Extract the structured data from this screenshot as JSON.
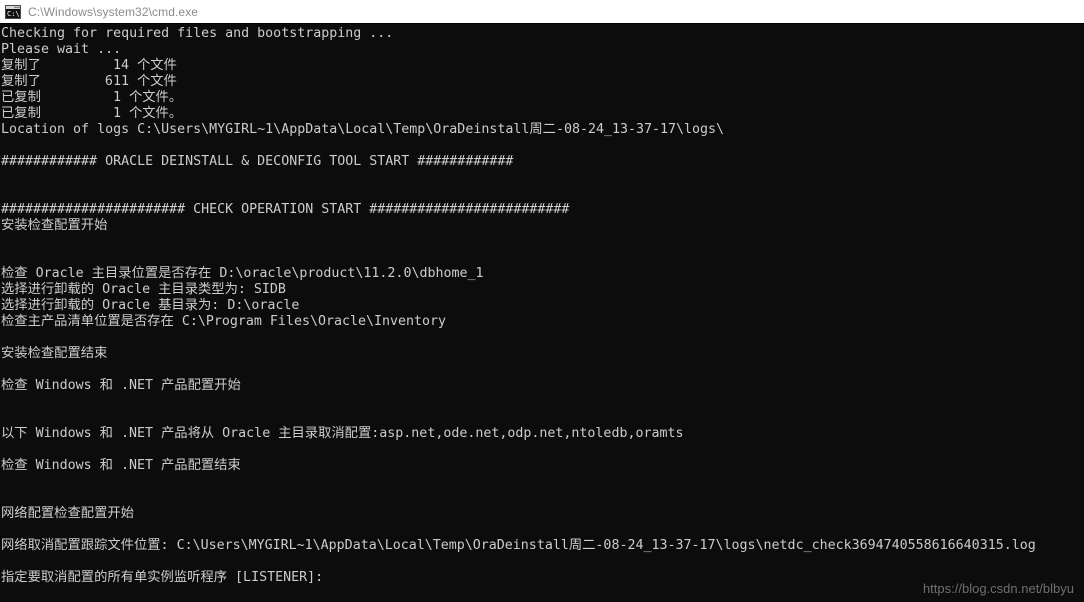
{
  "window": {
    "title": "C:\\Windows\\system32\\cmd.exe",
    "icon": "cmd-console-icon",
    "titlebar_bg": "#ffffff",
    "titlebar_fg": "#8a8a8a",
    "console_bg": "#0c0c0c",
    "console_fg": "#cccccc"
  },
  "console": {
    "lines": [
      "Checking for required files and bootstrapping ...",
      "Please wait ...",
      "复制了         14 个文件",
      "复制了        611 个文件",
      "已复制         1 个文件。",
      "已复制         1 个文件。",
      "Location of logs C:\\Users\\MYGIRL~1\\AppData\\Local\\Temp\\OraDeinstall周二-08-24_13-37-17\\logs\\",
      "",
      "############ ORACLE DEINSTALL & DECONFIG TOOL START ############",
      "",
      "",
      "####################### CHECK OPERATION START #########################",
      "安装检查配置开始",
      "",
      "",
      "检查 Oracle 主目录位置是否存在 D:\\oracle\\product\\11.2.0\\dbhome_1",
      "选择进行卸载的 Oracle 主目录类型为: SIDB",
      "选择进行卸载的 Oracle 基目录为: D:\\oracle",
      "检查主产品清单位置是否存在 C:\\Program Files\\Oracle\\Inventory",
      "",
      "安装检查配置结束",
      "",
      "检查 Windows 和 .NET 产品配置开始",
      "",
      "",
      "以下 Windows 和 .NET 产品将从 Oracle 主目录取消配置:asp.net,ode.net,odp.net,ntoledb,oramts",
      "",
      "检查 Windows 和 .NET 产品配置结束",
      "",
      "",
      "网络配置检查配置开始",
      "",
      "网络取消配置跟踪文件位置: C:\\Users\\MYGIRL~1\\AppData\\Local\\Temp\\OraDeinstall周二-08-24_13-37-17\\logs\\netdc_check3694740558616640315.log",
      "",
      "指定要取消配置的所有单实例监听程序 [LISTENER]:"
    ]
  },
  "watermark": {
    "text": "https://blog.csdn.net/blbyu"
  }
}
